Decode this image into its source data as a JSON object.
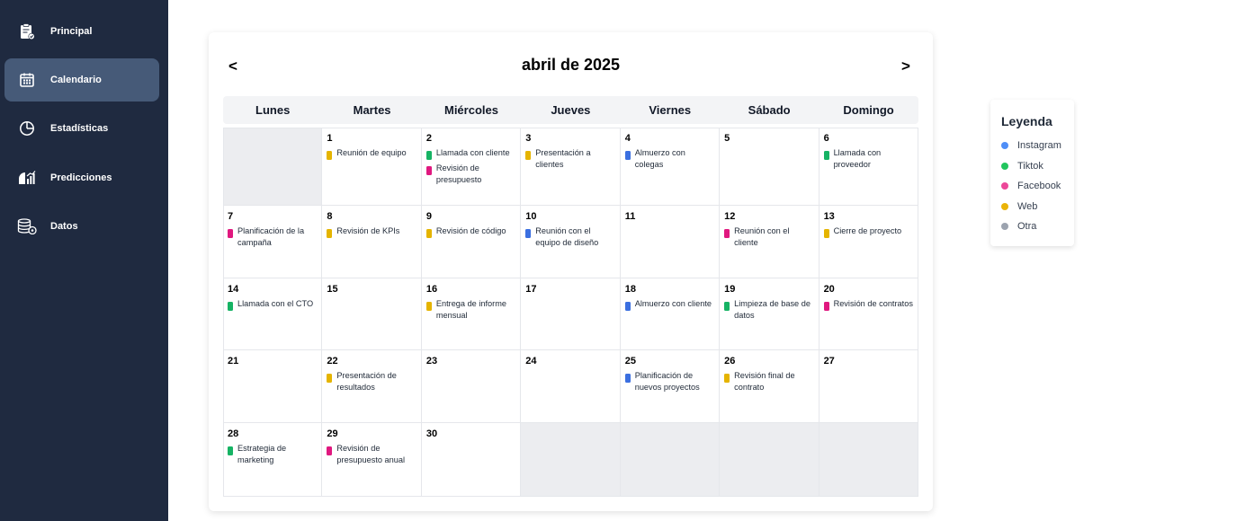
{
  "sidebar": {
    "items": [
      {
        "key": "principal",
        "label": "Principal",
        "icon": "clipboard-check-icon",
        "active": false
      },
      {
        "key": "calendario",
        "label": "Calendario",
        "icon": "calendar-icon",
        "active": true
      },
      {
        "key": "estadisticas",
        "label": "Estadísticas",
        "icon": "pie-chart-icon",
        "active": false
      },
      {
        "key": "predicciones",
        "label": "Predicciones",
        "icon": "chart-bars-icon",
        "active": false
      },
      {
        "key": "datos",
        "label": "Datos",
        "icon": "database-icon",
        "active": false
      }
    ]
  },
  "calendar": {
    "prev_label": "<",
    "next_label": ">",
    "title": "abril de 2025",
    "weekdays": [
      "Lunes",
      "Martes",
      "Miércoles",
      "Jueves",
      "Viernes",
      "Sábado",
      "Domingo"
    ],
    "weeks": [
      [
        null,
        {
          "day": "1",
          "events": [
            {
              "text": "Reunión de equipo",
              "category": "web"
            }
          ]
        },
        {
          "day": "2",
          "events": [
            {
              "text": "Llamada con cliente",
              "category": "tiktok"
            },
            {
              "text": "Revisión de presupuesto",
              "category": "facebook"
            }
          ]
        },
        {
          "day": "3",
          "events": [
            {
              "text": "Presentación a clientes",
              "category": "web"
            }
          ]
        },
        {
          "day": "4",
          "events": [
            {
              "text": "Almuerzo con colegas",
              "category": "instagram"
            }
          ]
        },
        {
          "day": "5",
          "events": []
        },
        {
          "day": "6",
          "events": [
            {
              "text": "Llamada con proveedor",
              "category": "tiktok"
            }
          ]
        }
      ],
      [
        {
          "day": "7",
          "events": [
            {
              "text": "Planificación de la campaña",
              "category": "facebook"
            }
          ]
        },
        {
          "day": "8",
          "events": [
            {
              "text": "Revisión de KPIs",
              "category": "web"
            }
          ]
        },
        {
          "day": "9",
          "events": [
            {
              "text": "Revisión de código",
              "category": "web"
            }
          ]
        },
        {
          "day": "10",
          "events": [
            {
              "text": "Reunión con el equipo de diseño",
              "category": "instagram"
            }
          ]
        },
        {
          "day": "11",
          "events": []
        },
        {
          "day": "12",
          "events": [
            {
              "text": "Reunión con el cliente",
              "category": "facebook"
            }
          ]
        },
        {
          "day": "13",
          "events": [
            {
              "text": "Cierre de proyecto",
              "category": "web"
            }
          ]
        }
      ],
      [
        {
          "day": "14",
          "events": [
            {
              "text": "Llamada con el CTO",
              "category": "tiktok"
            }
          ]
        },
        {
          "day": "15",
          "events": []
        },
        {
          "day": "16",
          "events": [
            {
              "text": "Entrega de informe mensual",
              "category": "web"
            }
          ]
        },
        {
          "day": "17",
          "events": []
        },
        {
          "day": "18",
          "events": [
            {
              "text": "Almuerzo con cliente",
              "category": "instagram"
            }
          ]
        },
        {
          "day": "19",
          "events": [
            {
              "text": "Limpieza de base de datos",
              "category": "tiktok"
            }
          ]
        },
        {
          "day": "20",
          "events": [
            {
              "text": "Revisión de contratos",
              "category": "facebook"
            }
          ]
        }
      ],
      [
        {
          "day": "21",
          "events": []
        },
        {
          "day": "22",
          "events": [
            {
              "text": "Presentación de resultados",
              "category": "web"
            }
          ]
        },
        {
          "day": "23",
          "events": []
        },
        {
          "day": "24",
          "events": []
        },
        {
          "day": "25",
          "events": [
            {
              "text": "Planificación de nuevos proyectos",
              "category": "instagram"
            }
          ]
        },
        {
          "day": "26",
          "events": [
            {
              "text": "Revisión final de contrato",
              "category": "web"
            }
          ]
        },
        {
          "day": "27",
          "events": []
        }
      ],
      [
        {
          "day": "28",
          "events": [
            {
              "text": "Estrategia de marketing",
              "category": "tiktok"
            }
          ]
        },
        {
          "day": "29",
          "events": [
            {
              "text": "Revisión de presupuesto anual",
              "category": "facebook"
            }
          ]
        },
        {
          "day": "30",
          "events": []
        },
        null,
        null,
        null,
        null
      ]
    ]
  },
  "legend": {
    "title": "Leyenda",
    "items": [
      {
        "key": "instagram",
        "label": "Instagram",
        "color": "#4f8ef7"
      },
      {
        "key": "tiktok",
        "label": "Tiktok",
        "color": "#22c55e"
      },
      {
        "key": "facebook",
        "label": "Facebook",
        "color": "#ec4899"
      },
      {
        "key": "web",
        "label": "Web",
        "color": "#eab308"
      },
      {
        "key": "otra",
        "label": "Otra",
        "color": "#9ca3af"
      }
    ]
  },
  "colors": {
    "sidebar_bg": "#1f2a40",
    "sidebar_active": "#465a78",
    "event_instagram": "#3b6fe0",
    "event_tiktok": "#16b364",
    "event_facebook": "#e0187f",
    "event_web": "#e5b400"
  }
}
